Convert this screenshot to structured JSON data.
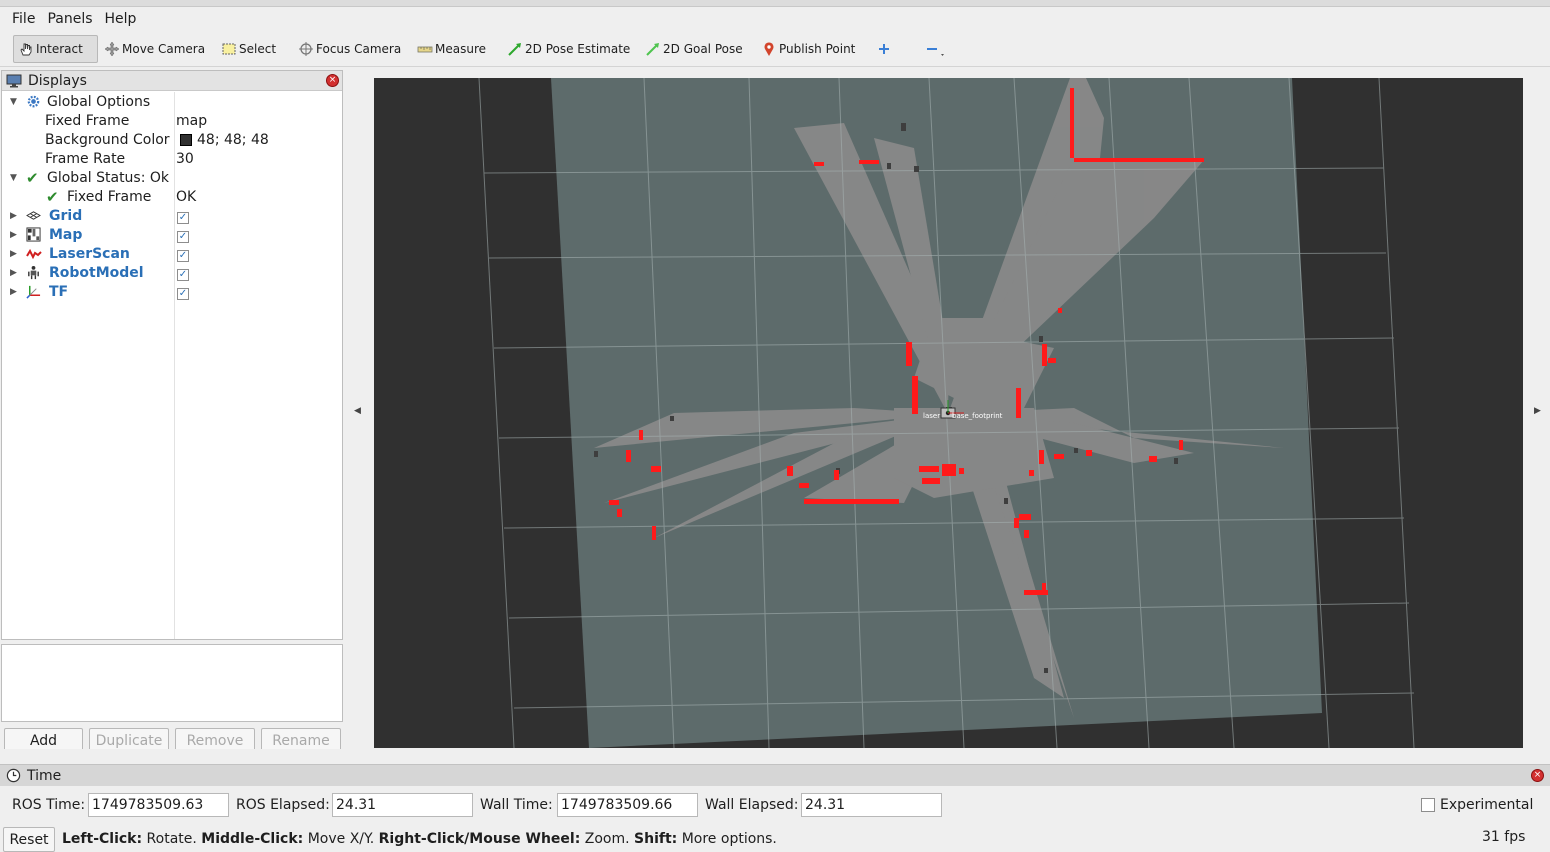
{
  "menu": {
    "file": "File",
    "panels": "Panels",
    "help": "Help"
  },
  "toolbar": {
    "interact": "Interact",
    "move_camera": "Move Camera",
    "select": "Select",
    "focus_camera": "Focus Camera",
    "measure": "Measure",
    "pose_estimate": "2D Pose Estimate",
    "goal_pose": "2D Goal Pose",
    "publish_point": "Publish Point"
  },
  "displays": {
    "title": "Displays",
    "global_options": "Global Options",
    "fixed_frame_label": "Fixed Frame",
    "fixed_frame_value": "map",
    "bg_color_label": "Background Color",
    "bg_color_value": "48; 48; 48",
    "frame_rate_label": "Frame Rate",
    "frame_rate_value": "30",
    "global_status": "Global Status: Ok",
    "status_fixed_frame": "Fixed Frame",
    "status_fixed_frame_value": "OK",
    "items": [
      {
        "label": "Grid",
        "enabled": true
      },
      {
        "label": "Map",
        "enabled": true
      },
      {
        "label": "LaserScan",
        "enabled": true
      },
      {
        "label": "RobotModel",
        "enabled": true
      },
      {
        "label": "TF",
        "enabled": true
      }
    ]
  },
  "buttons": {
    "add": "Add",
    "duplicate": "Duplicate",
    "remove": "Remove",
    "rename": "Rename"
  },
  "viewport": {
    "robot_frames": [
      "laser",
      "base_footprint"
    ],
    "colors": {
      "background": "#303030",
      "map": "#5d6b6b",
      "free": "#898989",
      "scan": "#ff0000"
    }
  },
  "time": {
    "title": "Time",
    "ros_time_label": "ROS Time:",
    "ros_time": "1749783509.63",
    "ros_elapsed_label": "ROS Elapsed:",
    "ros_elapsed": "24.31",
    "wall_time_label": "Wall Time:",
    "wall_time": "1749783509.66",
    "wall_elapsed_label": "Wall Elapsed:",
    "wall_elapsed": "24.31",
    "experimental": "Experimental"
  },
  "status": {
    "reset": "Reset",
    "left_click": "Left-Click:",
    "left_click_text": " Rotate. ",
    "middle_click": "Middle-Click:",
    "middle_click_text": " Move X/Y. ",
    "right_click": "Right-Click/Mouse Wheel:",
    "right_click_text": " Zoom. ",
    "shift": "Shift:",
    "shift_text": " More options.",
    "fps": "31 fps"
  }
}
